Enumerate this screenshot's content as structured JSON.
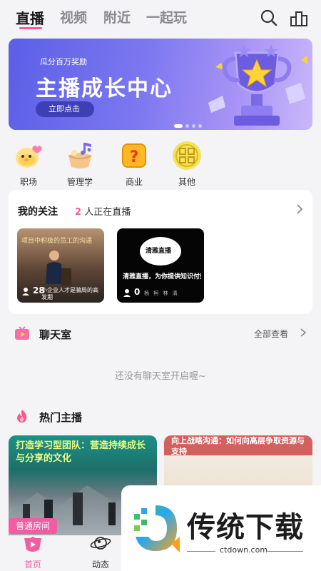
{
  "topnav": {
    "tabs": [
      {
        "label": "直播",
        "active": true
      },
      {
        "label": "视频",
        "active": false
      },
      {
        "label": "附近",
        "active": false
      },
      {
        "label": "一起玩",
        "active": false
      }
    ],
    "icons": [
      "search-icon",
      "ranking-icon"
    ],
    "accent_color": "#f25ca0"
  },
  "banner": {
    "subtitle": "瓜分百万奖励",
    "title": "主播成长中心",
    "button_label": "立即点击"
  },
  "categories": [
    {
      "label": "职场",
      "icon": "chick-icon"
    },
    {
      "label": "管理学",
      "icon": "music-note-icon"
    },
    {
      "label": "商业",
      "icon": "question-mark-icon"
    },
    {
      "label": "其他",
      "icon": "other-icon"
    }
  ],
  "follow": {
    "title": "我的关注",
    "count": "2",
    "count_suffix": "人正在直播",
    "lives": [
      {
        "top_text": "项目中积极的员工的沟通",
        "caption": "小企业人才是骗局的高发期",
        "viewers": "28"
      },
      {
        "logo_text": "清雅直播",
        "caption": "清雅直播，为你提供知识付费。",
        "viewers": "0",
        "handle": "杨 柯 林 清"
      }
    ]
  },
  "chatroom": {
    "title": "聊天室",
    "see_all": "全部查看",
    "empty_text": "还没有聊天室开启喔~"
  },
  "hot": {
    "title": "热门主播",
    "cards": [
      {
        "title": "打造学习型团队：营造持续成长与分享的文化",
        "badge": "普通房间"
      },
      {
        "title": "向上战略沟通：如何向高层争取资源与支持"
      }
    ]
  },
  "watermark": {
    "text": "传统下载",
    "url": "ctdown.com"
  },
  "bottom_tabs": [
    {
      "label": "首页",
      "active": true,
      "color": "#f25ca0"
    },
    {
      "label": "动态",
      "active": false,
      "color": "#333333"
    }
  ]
}
